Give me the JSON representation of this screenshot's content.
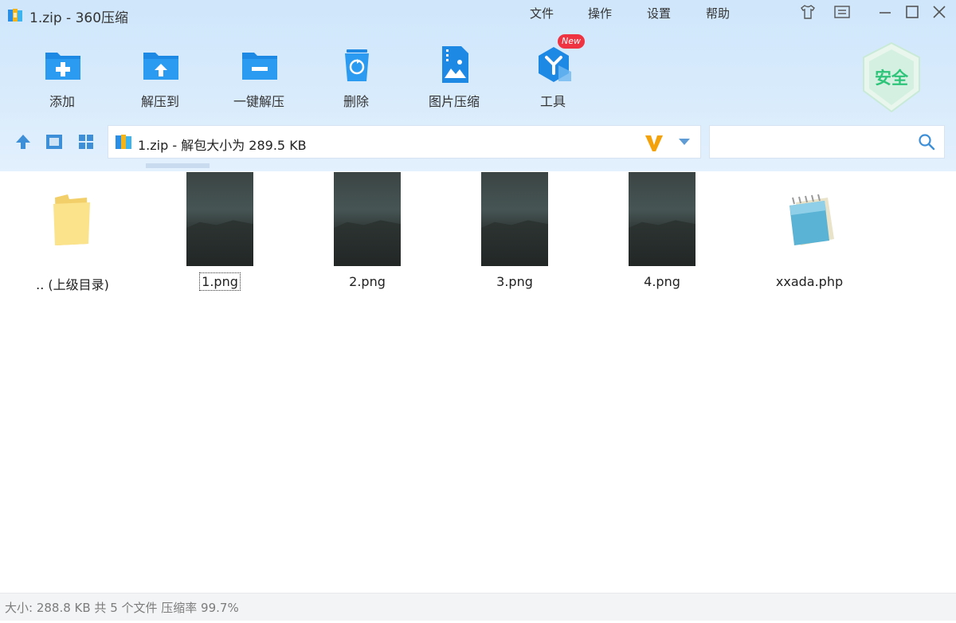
{
  "window": {
    "title": "1.zip - 360压缩",
    "menu": [
      "文件",
      "操作",
      "设置",
      "帮助"
    ]
  },
  "toolbar": {
    "items": [
      {
        "label": "添加",
        "icon": "folder-add-icon"
      },
      {
        "label": "解压到",
        "icon": "folder-extract-icon"
      },
      {
        "label": "一键解压",
        "icon": "folder-oneclick-icon"
      },
      {
        "label": "删除",
        "icon": "recycle-bin-icon"
      },
      {
        "label": "图片压缩",
        "icon": "image-compress-icon"
      },
      {
        "label": "工具",
        "icon": "tools-icon"
      }
    ],
    "new_badge": "New",
    "security_label": "安全"
  },
  "address": {
    "text": "1.zip - 解包大小为 289.5 KB"
  },
  "search": {
    "placeholder": ""
  },
  "files": [
    {
      "name": ".. (上级目录)",
      "type": "parent-folder"
    },
    {
      "name": "1.png",
      "type": "image"
    },
    {
      "name": "2.png",
      "type": "image"
    },
    {
      "name": "3.png",
      "type": "image"
    },
    {
      "name": "4.png",
      "type": "image"
    },
    {
      "name": "xxada.php",
      "type": "php"
    }
  ],
  "status": {
    "text": "大小: 288.8 KB 共 5 个文件 压缩率 99.7%"
  },
  "colors": {
    "accent_blue": "#1e90e8",
    "header_bg": "#d3e8fb",
    "badge_red": "#ef3340",
    "shield_green": "#2ec47a"
  }
}
